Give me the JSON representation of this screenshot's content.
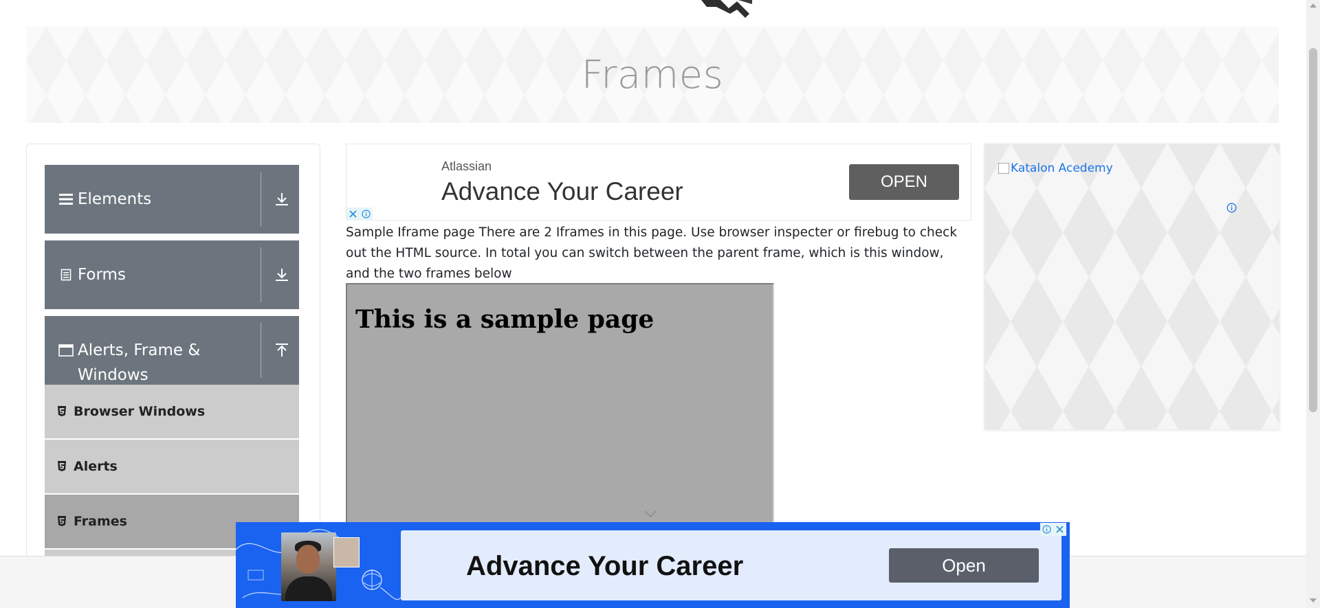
{
  "page": {
    "title": "Frames"
  },
  "sidebar": {
    "groups": [
      {
        "label": "Elements",
        "icon": "hamburger-icon",
        "arrow": "download-arrow-icon"
      },
      {
        "label": "Forms",
        "icon": "document-icon",
        "arrow": "download-arrow-icon"
      },
      {
        "label": "Alerts, Frame & Windows",
        "icon": "window-icon",
        "arrow": "upload-arrow-icon"
      }
    ],
    "items": [
      {
        "label": "Browser Windows",
        "icon": "html5-icon",
        "active": false
      },
      {
        "label": "Alerts",
        "icon": "html5-icon",
        "active": false
      },
      {
        "label": "Frames",
        "icon": "html5-icon",
        "active": true
      }
    ]
  },
  "top_ad": {
    "brand": "Atlassian",
    "headline": "Advance Your Career",
    "cta": "OPEN"
  },
  "main": {
    "description": "Sample Iframe page There are 2 Iframes in this page. Use browser inspecter or firebug to check out the HTML source. In total you can switch between the parent frame, which is this window, and the two frames below",
    "iframe_heading": "This is a sample page"
  },
  "side_ad": {
    "image_alt": "Katalon Acedemy"
  },
  "bottom_ad": {
    "headline": "Advance Your Career",
    "cta": "Open"
  },
  "colors": {
    "sidebar_group": "#6c757d",
    "sidebar_item": "#cccccc",
    "sidebar_item_active": "#a8a8a8",
    "bottom_ad_bg": "#1a63f0",
    "link": "#1a73e8"
  }
}
